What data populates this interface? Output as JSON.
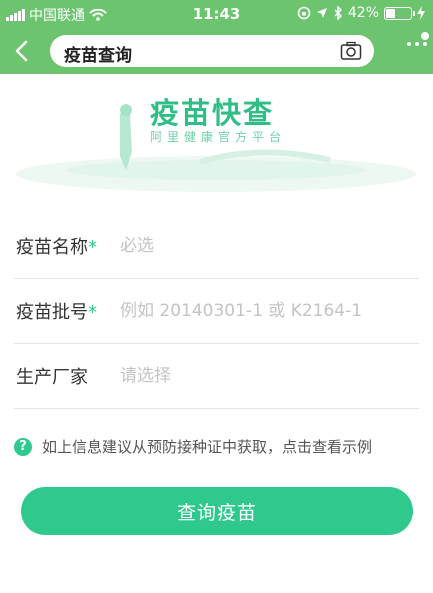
{
  "status_bar": {
    "carrier": "中国联通",
    "time": "11:43",
    "battery_text": "42%",
    "battery_level": 0.42
  },
  "nav": {
    "search_text": "疫苗查询"
  },
  "banner": {
    "title": "疫苗快查",
    "subtitle": "阿里健康官方平台"
  },
  "form": {
    "rows": [
      {
        "label": "疫苗名称",
        "required_mark": "*",
        "placeholder": "必选"
      },
      {
        "label": "疫苗批号",
        "required_mark": "*",
        "placeholder": "例如 20140301-1 或 K2164-1"
      },
      {
        "label": "生产厂家",
        "required_mark": "",
        "placeholder": "请选择"
      }
    ]
  },
  "hint": {
    "icon_glyph": "?",
    "text": "如上信息建议从预防接种证中获取，点击查看示例"
  },
  "submit": {
    "label": "查询疫苗"
  },
  "colors": {
    "header_green": "#6cc46f",
    "accent": "#2fc98d"
  }
}
